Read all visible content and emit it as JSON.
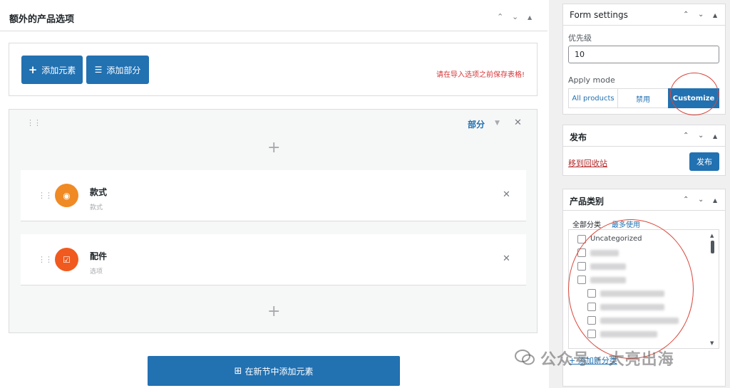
{
  "main": {
    "title": "额外的产品选项",
    "header_controls": [
      "chevron-up-icon",
      "chevron-down-icon",
      "triangle-up-icon"
    ],
    "add_element_label": "添加元素",
    "add_section_label": "添加部分",
    "save_warning": "请在导入选项之前保存表格!",
    "section": {
      "label": "部分",
      "elements": [
        {
          "title": "款式",
          "subtitle": "款式",
          "icon": "radio-icon",
          "color": "#f08a24"
        },
        {
          "title": "配件",
          "subtitle": "选项",
          "icon": "checkbox-icon",
          "color": "#f05a1e"
        }
      ]
    },
    "add_element_in_new_section": "在新节中添加元素"
  },
  "sidebar": {
    "form_settings": {
      "title": "Form settings",
      "priority_label": "优先级",
      "priority_value": "10",
      "apply_mode_label": "Apply mode",
      "apply_modes": [
        "All products",
        "禁用",
        "Customize"
      ],
      "active_mode": "Customize"
    },
    "publish": {
      "title": "发布",
      "trash_label": "移到回收站",
      "publish_label": "发布"
    },
    "categories": {
      "title": "产品类别",
      "tab_all": "全部分类",
      "tab_most_used": "最多使用",
      "items": [
        "Uncategorized"
      ],
      "add_new_label": "+ 添加新分类"
    }
  },
  "watermark": "公众号 · 大亮出海",
  "colors": {
    "accent": "#2271b1",
    "danger": "#d63638",
    "annotation": "#d9473b"
  }
}
